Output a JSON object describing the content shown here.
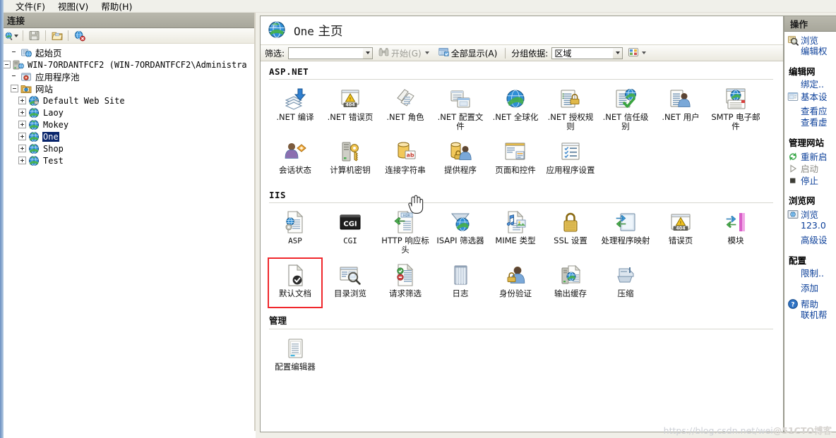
{
  "menubar": {
    "items": [
      {
        "label": "文件(F)",
        "name": "menu-file"
      },
      {
        "label": "视图(V)",
        "name": "menu-view"
      },
      {
        "label": "帮助(H)",
        "name": "menu-help"
      }
    ]
  },
  "connections": {
    "title": "连接",
    "toolbar": [
      {
        "name": "connect-icon",
        "label": "连接"
      },
      {
        "name": "save-icon",
        "label": "保存"
      },
      {
        "name": "open-folder-icon",
        "label": "打开"
      },
      {
        "name": "disconnect-icon",
        "label": "断开连接"
      }
    ],
    "tree": [
      {
        "label": "起始页",
        "icon": "start-page-icon",
        "indent": 1,
        "expander": "none",
        "script": "cjk",
        "selected": false
      },
      {
        "label": "WIN-7ORDANTFCF2 (WIN-7ORDANTFCF2\\Administra",
        "icon": "server-icon",
        "indent": 0,
        "expander": "minus",
        "script": "latin",
        "selected": false
      },
      {
        "label": "应用程序池",
        "icon": "app-pool-icon",
        "indent": 1,
        "expander": "none",
        "script": "cjk",
        "selected": false
      },
      {
        "label": "网站",
        "icon": "sites-folder-icon",
        "indent": 1,
        "expander": "minus",
        "script": "cjk",
        "selected": false
      },
      {
        "label": "Default Web Site",
        "icon": "site-locked-icon",
        "indent": 2,
        "expander": "plus",
        "script": "latin",
        "selected": false
      },
      {
        "label": "Laoy",
        "icon": "site-icon",
        "indent": 2,
        "expander": "plus",
        "script": "latin",
        "selected": false
      },
      {
        "label": "Mokey",
        "icon": "site-icon",
        "indent": 2,
        "expander": "plus",
        "script": "latin",
        "selected": false
      },
      {
        "label": "One",
        "icon": "site-icon",
        "indent": 2,
        "expander": "plus",
        "script": "latin",
        "selected": true
      },
      {
        "label": "Shop",
        "icon": "site-icon",
        "indent": 2,
        "expander": "plus",
        "script": "latin",
        "selected": false
      },
      {
        "label": "Test",
        "icon": "site-icon",
        "indent": 2,
        "expander": "plus",
        "script": "latin",
        "selected": false
      }
    ]
  },
  "main": {
    "title_site": "One",
    "title_suffix": "主页",
    "title_icon": "site-globe-icon",
    "filter": {
      "label": "筛选:",
      "value": "",
      "placeholder": "",
      "go_label": "开始(G)",
      "show_all_label": "全部显示(A)",
      "group_by_label": "分组依据:",
      "group_by_value": "区域",
      "view_icon": "view-mode-icon"
    },
    "sections": [
      {
        "name": "asp-net",
        "heading": "ASP.NET",
        "heading_script": "latin",
        "items": [
          {
            "label": ".NET 编译",
            "icon": "net-compilation-icon"
          },
          {
            "label": ".NET 错误页",
            "icon": "net-error-pages-icon"
          },
          {
            "label": ".NET 角色",
            "icon": "net-roles-icon"
          },
          {
            "label": ".NET 配置文件",
            "icon": "net-profile-icon"
          },
          {
            "label": ".NET 全球化",
            "icon": "net-globalization-icon"
          },
          {
            "label": ".NET 授权规则",
            "icon": "net-authorization-rules-icon"
          },
          {
            "label": ".NET 信任级别",
            "icon": "net-trust-levels-icon"
          },
          {
            "label": ".NET 用户",
            "icon": "net-users-icon"
          },
          {
            "label": "SMTP 电子邮件",
            "icon": "smtp-email-icon"
          },
          {
            "label": "会话状态",
            "icon": "session-state-icon"
          },
          {
            "label": "计算机密钥",
            "icon": "machine-key-icon"
          },
          {
            "label": "连接字符串",
            "icon": "connection-strings-icon"
          },
          {
            "label": "提供程序",
            "icon": "providers-icon"
          },
          {
            "label": "页面和控件",
            "icon": "pages-and-controls-icon"
          },
          {
            "label": "应用程序设置",
            "icon": "application-settings-icon"
          }
        ]
      },
      {
        "name": "iis",
        "heading": "IIS",
        "heading_script": "latin",
        "items": [
          {
            "label": "ASP",
            "icon": "asp-icon"
          },
          {
            "label": "CGI",
            "icon": "cgi-icon"
          },
          {
            "label": "HTTP 响应标头",
            "icon": "http-response-headers-icon"
          },
          {
            "label": "ISAPI 筛选器",
            "icon": "isapi-filters-icon"
          },
          {
            "label": "MIME 类型",
            "icon": "mime-types-icon"
          },
          {
            "label": "SSL 设置",
            "icon": "ssl-settings-icon"
          },
          {
            "label": "处理程序映射",
            "icon": "handler-mappings-icon"
          },
          {
            "label": "错误页",
            "icon": "error-pages-icon"
          },
          {
            "label": "模块",
            "icon": "modules-icon"
          },
          {
            "label": "默认文档",
            "icon": "default-document-icon",
            "selected": true
          },
          {
            "label": "目录浏览",
            "icon": "directory-browsing-icon"
          },
          {
            "label": "请求筛选",
            "icon": "request-filtering-icon"
          },
          {
            "label": "日志",
            "icon": "logging-icon"
          },
          {
            "label": "身份验证",
            "icon": "authentication-icon"
          },
          {
            "label": "输出缓存",
            "icon": "output-caching-icon"
          },
          {
            "label": "压缩",
            "icon": "compression-icon"
          }
        ]
      },
      {
        "name": "management",
        "heading": "管理",
        "heading_script": "cjk",
        "items": [
          {
            "label": "配置编辑器",
            "icon": "configuration-editor-icon"
          }
        ]
      }
    ]
  },
  "actions": {
    "title": "操作",
    "entries": [
      {
        "type": "item",
        "label": "浏览",
        "icon": "browse-icon",
        "name": "action-browse"
      },
      {
        "type": "sub",
        "label": "编辑权",
        "name": "action-edit-permissions"
      },
      {
        "type": "sep"
      },
      {
        "type": "group",
        "label": "编辑网",
        "name": "actions-group-edit-site"
      },
      {
        "type": "sub",
        "label": "绑定..",
        "name": "action-bindings"
      },
      {
        "type": "item",
        "label": "基本设",
        "icon": "basic-settings-icon",
        "name": "action-basic-settings"
      },
      {
        "type": "sep"
      },
      {
        "type": "sub",
        "label": "查看应",
        "name": "action-view-applications"
      },
      {
        "type": "sub",
        "label": "查看虚",
        "name": "action-view-virtual-directories"
      },
      {
        "type": "sep"
      },
      {
        "type": "group",
        "label": "管理网站",
        "name": "actions-group-manage-site"
      },
      {
        "type": "item",
        "label": "重新启",
        "icon": "restart-icon",
        "name": "action-restart"
      },
      {
        "type": "item",
        "label": "启动",
        "icon": "start-icon",
        "name": "action-start",
        "dim": true
      },
      {
        "type": "item",
        "label": "停止",
        "icon": "stop-icon",
        "name": "action-stop"
      },
      {
        "type": "sep"
      },
      {
        "type": "group",
        "label": "浏览网",
        "name": "actions-group-browse-website"
      },
      {
        "type": "item",
        "label": "浏览 ",
        "icon": "browse-site-icon",
        "name": "action-browse-site"
      },
      {
        "type": "sub",
        "label": "123.0",
        "name": "action-browse-address"
      },
      {
        "type": "sep"
      },
      {
        "type": "sub",
        "label": "高级设",
        "name": "action-advanced-settings"
      },
      {
        "type": "sep"
      },
      {
        "type": "group",
        "label": "配置",
        "name": "actions-group-configure"
      },
      {
        "type": "sub",
        "label": "限制..",
        "name": "action-limits"
      },
      {
        "type": "sep"
      },
      {
        "type": "sub",
        "label": "添加 ",
        "name": "action-add"
      },
      {
        "type": "sep"
      },
      {
        "type": "item",
        "label": "帮助",
        "icon": "help-icon",
        "name": "action-help"
      },
      {
        "type": "sub",
        "label": "联机帮",
        "name": "action-online-help"
      }
    ]
  },
  "watermark": {
    "url": "https://blog.csdn.net/wei",
    "suffix": "@51CTO博客"
  }
}
